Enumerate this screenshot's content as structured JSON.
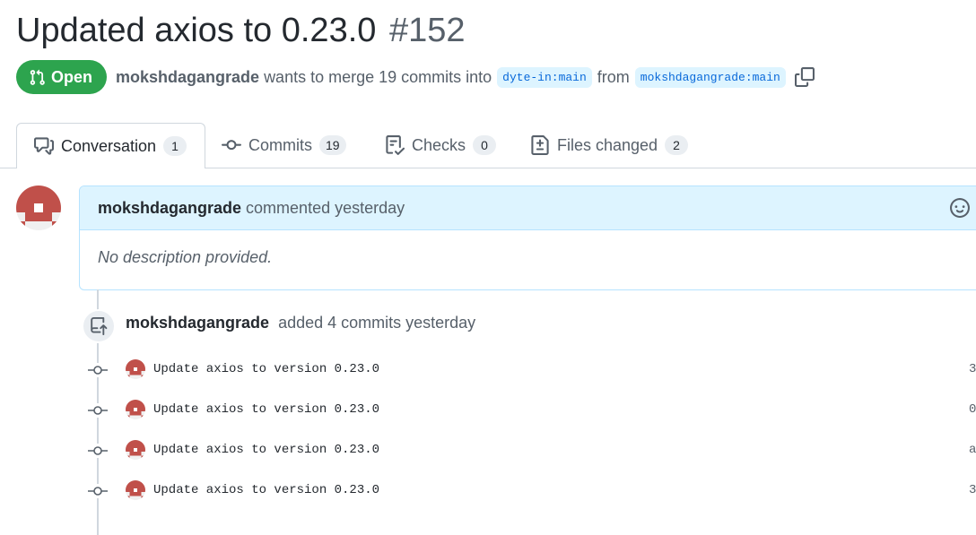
{
  "pr": {
    "title": "Updated axios to 0.23.0",
    "number": "#152",
    "state": "Open",
    "author": "mokshdagangrade",
    "merge_text": "wants to merge 19 commits into",
    "base_branch": "dyte-in:main",
    "from_text": "from",
    "head_branch": "mokshdagangrade:main"
  },
  "tabs": [
    {
      "label": "Conversation",
      "count": "1",
      "icon": "comment-discussion-icon"
    },
    {
      "label": "Commits",
      "count": "19",
      "icon": "git-commit-icon"
    },
    {
      "label": "Checks",
      "count": "0",
      "icon": "checklist-icon"
    },
    {
      "label": "Files changed",
      "count": "2",
      "icon": "file-diff-icon"
    }
  ],
  "comment": {
    "author": "mokshdagangrade",
    "action": "commented yesterday",
    "body": "No description provided."
  },
  "event": {
    "author": "mokshdagangrade",
    "text": "added 4 commits yesterday"
  },
  "commits": [
    {
      "message": "Update axios to version 0.23.0",
      "sha": "3"
    },
    {
      "message": "Update axios to version 0.23.0",
      "sha": "0"
    },
    {
      "message": "Update axios to version 0.23.0",
      "sha": "a"
    },
    {
      "message": "Update axios to version 0.23.0",
      "sha": "3"
    }
  ],
  "colors": {
    "open_green": "#2da44e",
    "accent_blue": "#0969da",
    "comment_header_bg": "#ddf4ff",
    "avatar_red": "#c0504a"
  }
}
